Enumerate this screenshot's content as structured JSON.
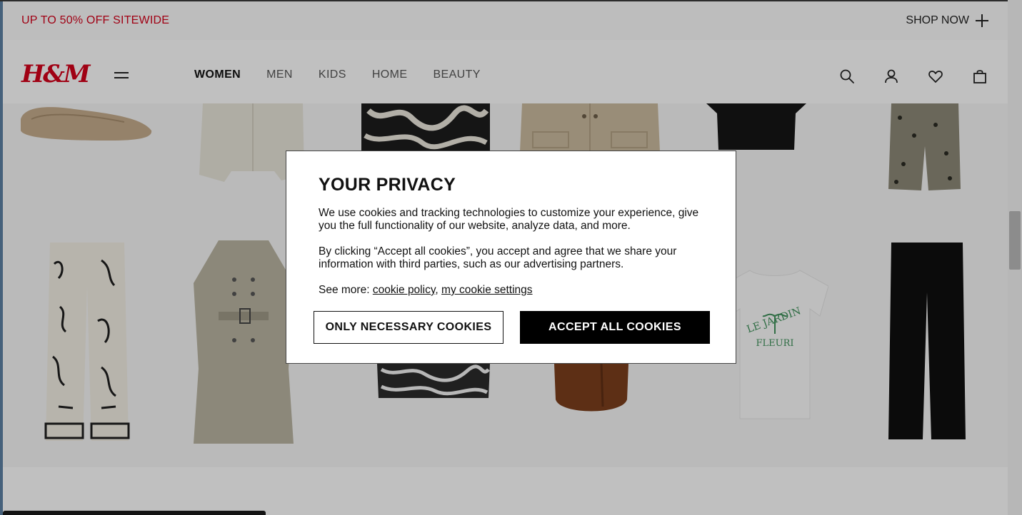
{
  "promo": {
    "text": "UP TO 50% OFF SITEWIDE",
    "shop_now": "SHOP NOW"
  },
  "header": {
    "logo": "H&M",
    "nav": [
      {
        "label": "WOMEN",
        "active": true
      },
      {
        "label": "MEN",
        "active": false
      },
      {
        "label": "KIDS",
        "active": false
      },
      {
        "label": "HOME",
        "active": false
      },
      {
        "label": "BEAUTY",
        "active": false
      }
    ],
    "icons": [
      "search-icon",
      "account-icon",
      "heart-icon",
      "bag-icon"
    ]
  },
  "products": [
    "ballet-flat",
    "blazer",
    "printed-dress",
    "jacket",
    "black-tshirt",
    "printed-pants",
    "printed-trousers",
    "trench-coat",
    "zebra-dress",
    "leather-bag",
    "graphic-tshirt",
    "black-trousers"
  ],
  "graphic_tee_text": [
    "LE JARDIN",
    "FLEURI"
  ],
  "modal": {
    "title": "YOUR PRIVACY",
    "paragraph1": "We use cookies and tracking technologies to customize your experience, give you the full functionality of our website, analyze data, and more.",
    "paragraph2": "By clicking “Accept all cookies”, you accept and agree that we share your information with third parties, such as our advertising partners.",
    "see_more": "See more:",
    "cookie_policy": "cookie policy",
    "separator": ",",
    "cookie_settings": "my cookie settings",
    "btn_necessary": "ONLY NECESSARY COOKIES",
    "btn_accept": "ACCEPT ALL COOKIES"
  },
  "colors": {
    "brand": "#d0021b",
    "text": "#111111"
  }
}
